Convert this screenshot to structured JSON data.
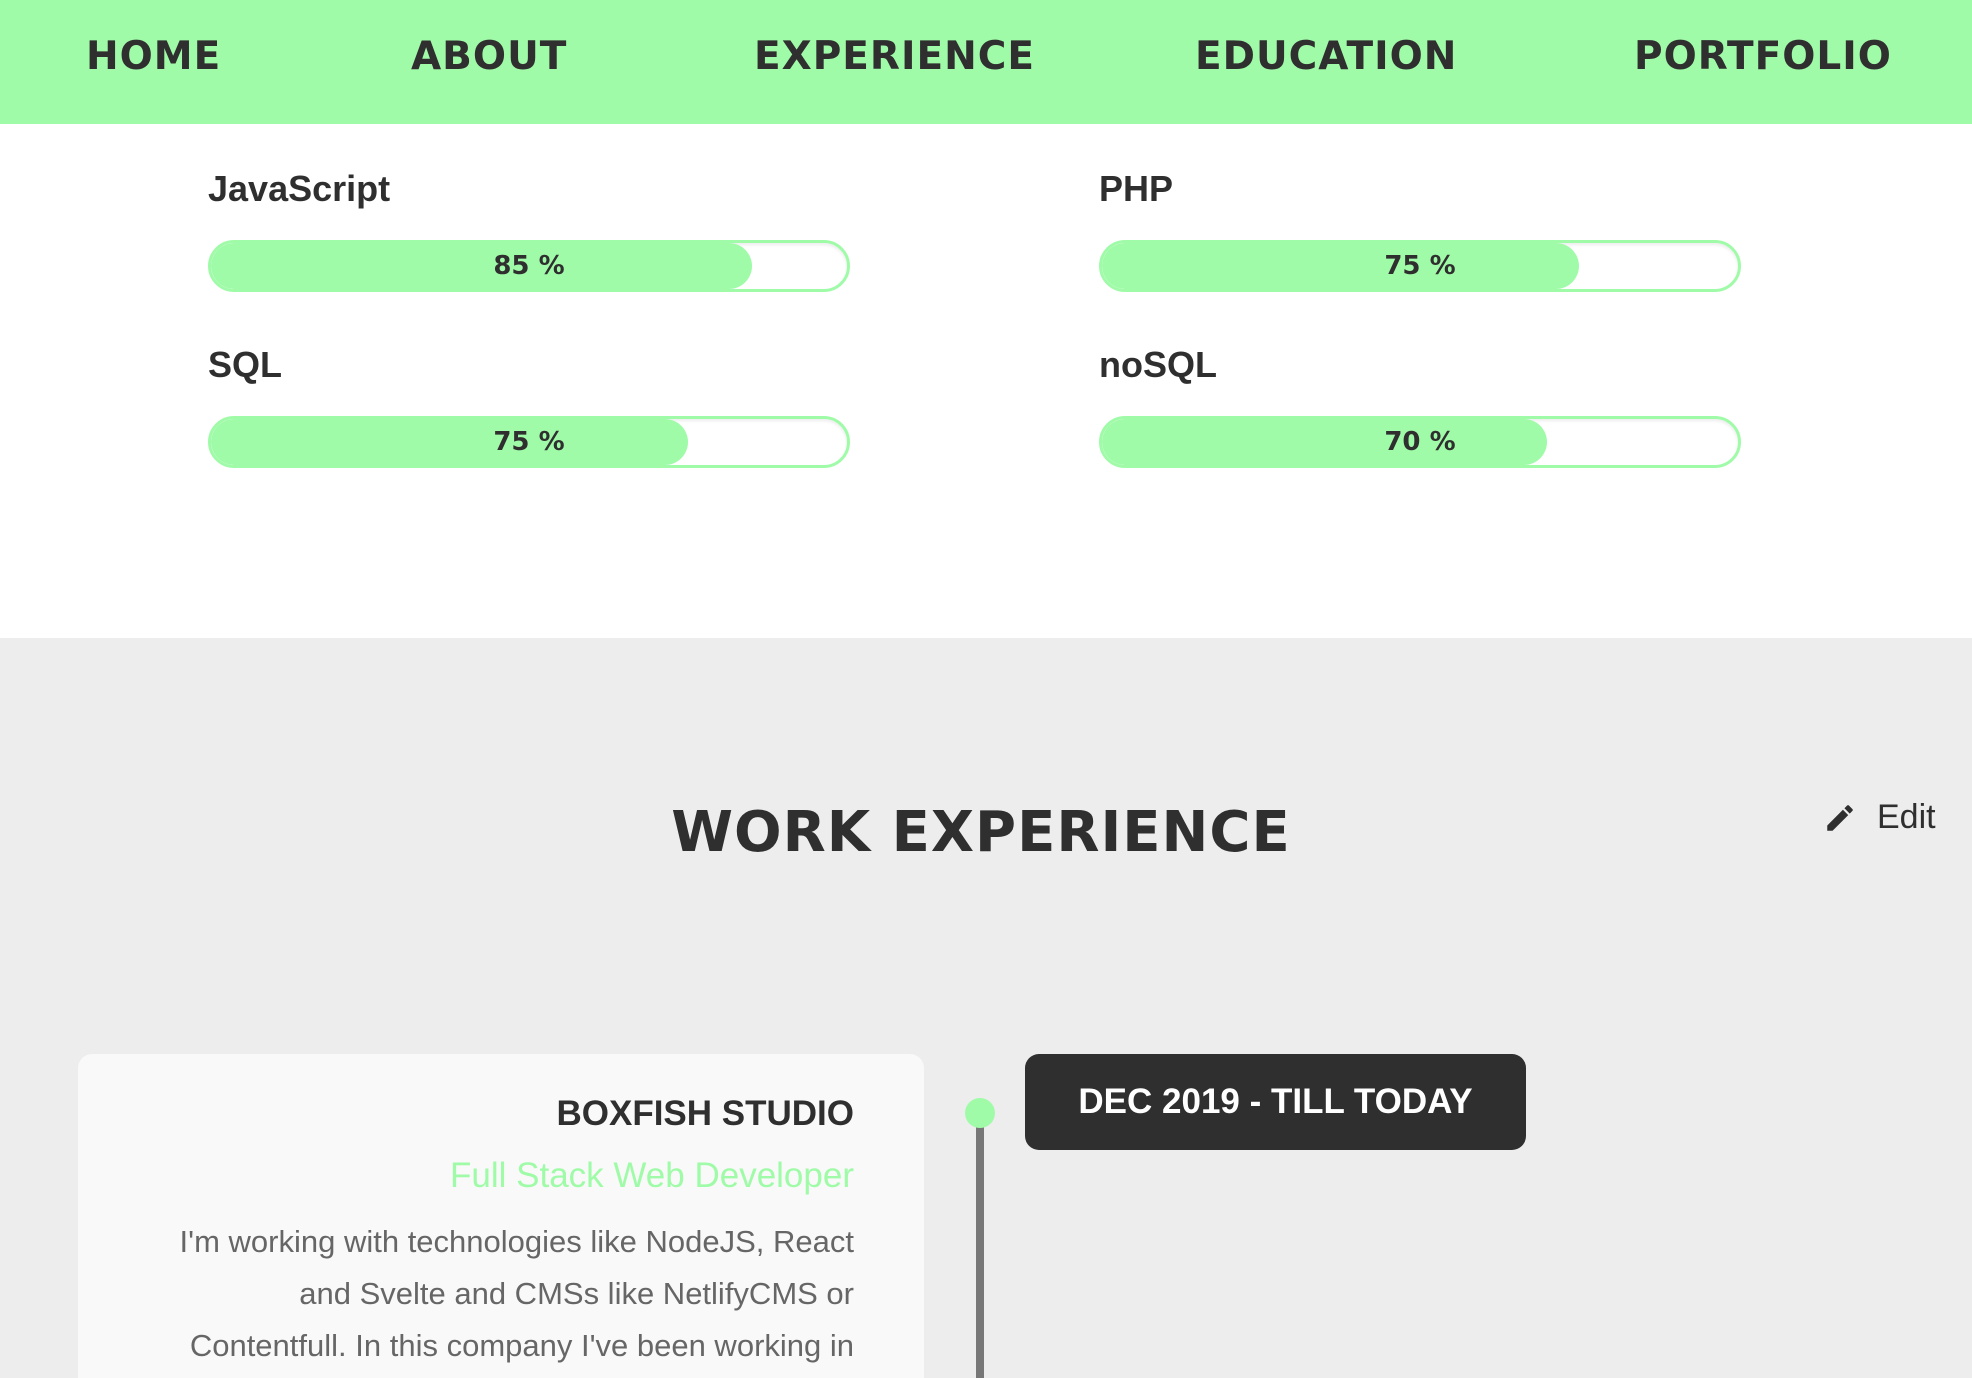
{
  "nav": {
    "items": [
      "HOME",
      "ABOUT",
      "EXPERIENCE",
      "EDUCATION",
      "PORTFOLIO"
    ]
  },
  "skills": [
    {
      "name": "JavaScript",
      "percent_label": "85 %",
      "level": 0.85
    },
    {
      "name": "PHP",
      "percent_label": "75 %",
      "level": 0.75
    },
    {
      "name": "SQL",
      "percent_label": "75 %",
      "level": 0.75
    },
    {
      "name": "noSQL",
      "percent_label": "70 %",
      "level": 0.7
    }
  ],
  "work": {
    "title": "WORK EXPERIENCE",
    "edit_label": "Edit",
    "entries": [
      {
        "company": "BOXFISH STUDIO",
        "role": "Full Stack Web Developer",
        "description": "I'm working with technologies like NodeJS, React and Svelte and CMSs like NetlifyCMS or Contentfull. In this company I've been working in",
        "date": "DEC 2019 - TILL TODAY"
      }
    ]
  },
  "colors": {
    "accent": "#a0fba8",
    "text": "#2f2f2f",
    "badge": "#2f2f2f",
    "section_bg": "#ededed"
  },
  "icons": {
    "edit": "pencil-icon"
  }
}
